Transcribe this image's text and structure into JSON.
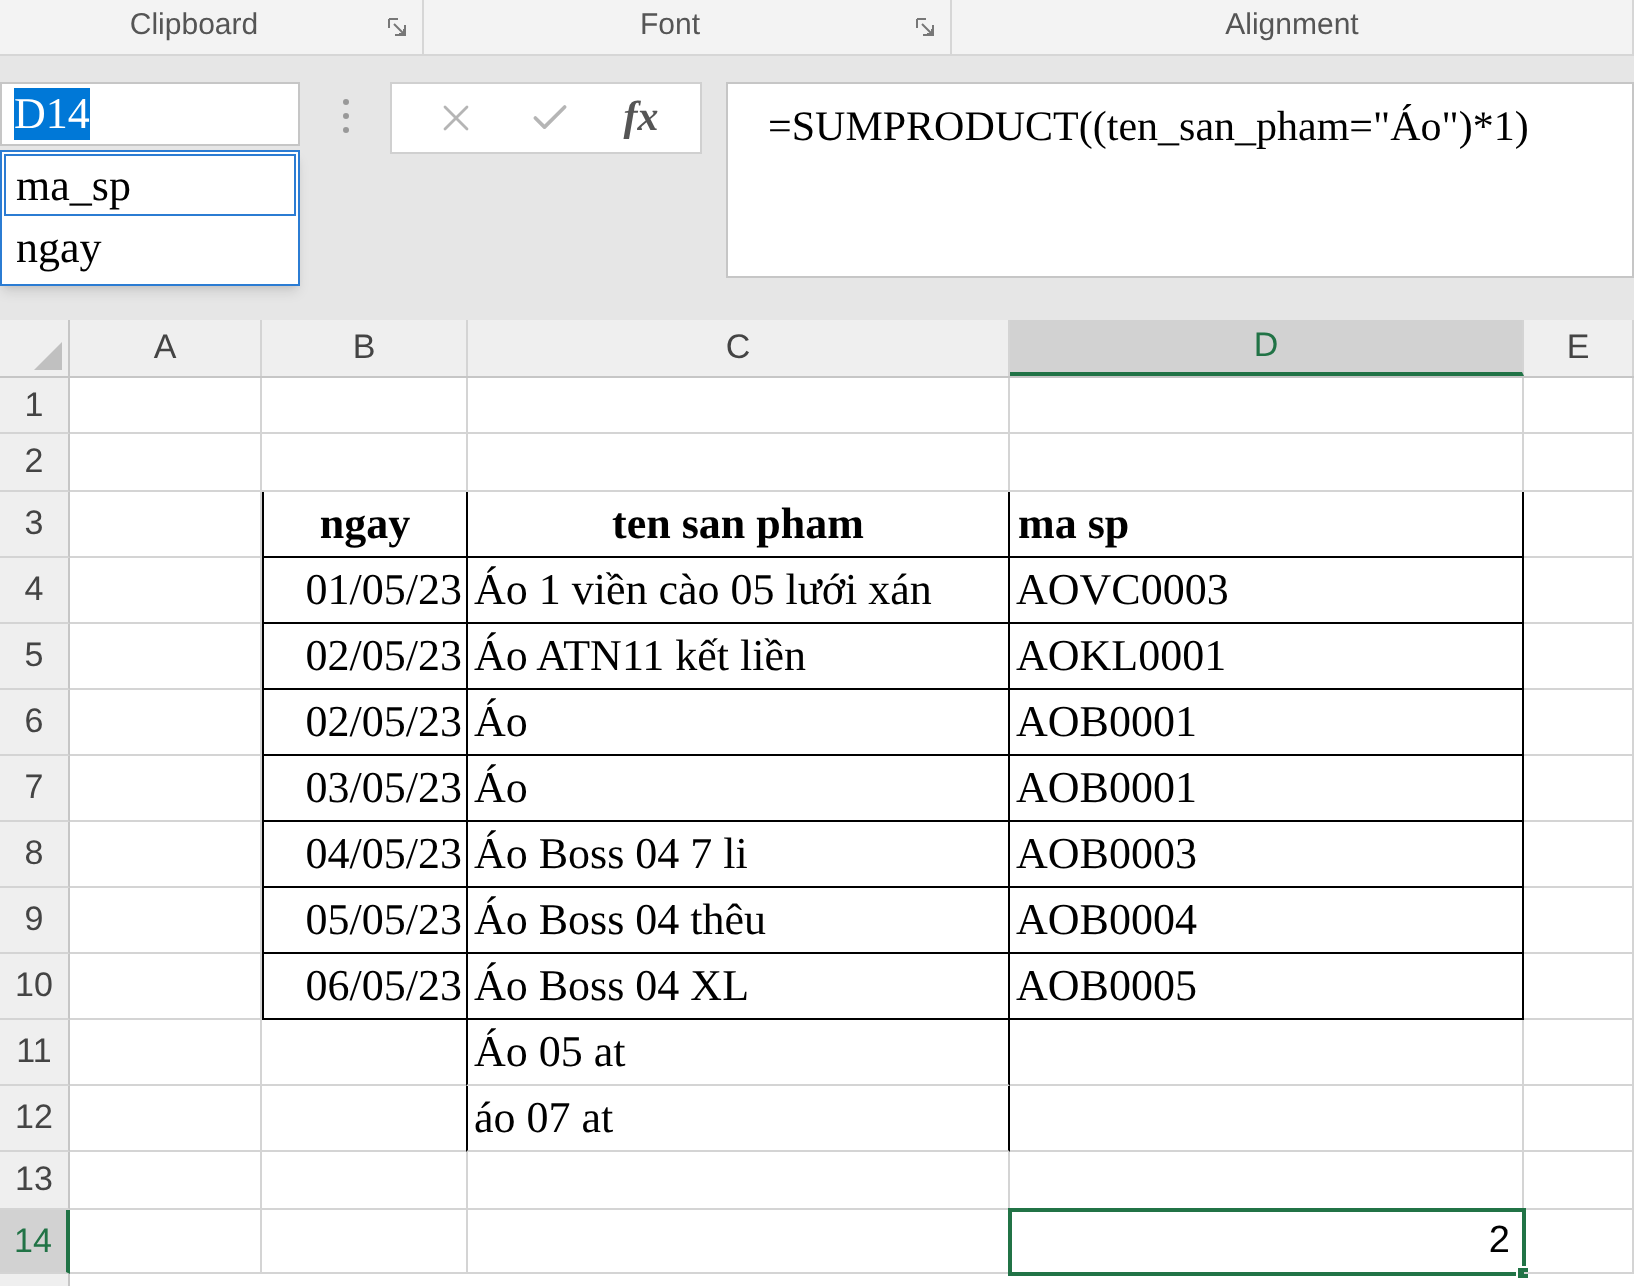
{
  "ribbon_groups": [
    {
      "label": "Clipboard",
      "launcher": true
    },
    {
      "label": "Font",
      "launcher": true
    },
    {
      "label": "Alignment",
      "launcher": false
    }
  ],
  "name_box": {
    "value": "D14",
    "highlighted": true
  },
  "name_list": [
    {
      "label": "ma_sp",
      "selected": true
    },
    {
      "label": "ngay",
      "selected": false
    }
  ],
  "fx_label": "fx",
  "formula": "=SUMPRODUCT((ten_san_pham=\"Áo\")*1)",
  "columns": [
    {
      "label": "A",
      "selected": false
    },
    {
      "label": "B",
      "selected": false
    },
    {
      "label": "C",
      "selected": false
    },
    {
      "label": "D",
      "selected": true
    },
    {
      "label": "E",
      "selected": false
    }
  ],
  "rows": [
    {
      "label": "1",
      "selected": false,
      "kind": "plain",
      "cells": {}
    },
    {
      "label": "2",
      "selected": false,
      "kind": "plain",
      "cells": {}
    },
    {
      "label": "3",
      "selected": false,
      "kind": "boxed",
      "cells": {
        "B": {
          "text": "ngay",
          "kind": "header",
          "active": false
        },
        "C": {
          "text": "ten san pham",
          "kind": "header",
          "active": false
        },
        "D": {
          "text": "ma sp",
          "kind": "header",
          "active": false
        }
      }
    },
    {
      "label": "4",
      "selected": false,
      "kind": "boxed",
      "cells": {
        "B": {
          "text": "01/05/23",
          "kind": "date",
          "active": false
        },
        "C": {
          "text": "Áo 1 viền cào 05 lưới xán",
          "kind": "text",
          "active": false
        },
        "D": {
          "text": "AOVC0003",
          "kind": "text",
          "active": false
        }
      }
    },
    {
      "label": "5",
      "selected": false,
      "kind": "boxed",
      "cells": {
        "B": {
          "text": "02/05/23",
          "kind": "date",
          "active": false
        },
        "C": {
          "text": "Áo ATN11 kết liền",
          "kind": "text",
          "active": false
        },
        "D": {
          "text": "AOKL0001",
          "kind": "text",
          "active": false
        }
      }
    },
    {
      "label": "6",
      "selected": false,
      "kind": "boxed",
      "cells": {
        "B": {
          "text": "02/05/23",
          "kind": "date",
          "active": false
        },
        "C": {
          "text": "Áo",
          "kind": "text",
          "active": false
        },
        "D": {
          "text": "AOB0001",
          "kind": "text",
          "active": false
        }
      }
    },
    {
      "label": "7",
      "selected": false,
      "kind": "boxed",
      "cells": {
        "B": {
          "text": "03/05/23",
          "kind": "date",
          "active": false
        },
        "C": {
          "text": "Áo",
          "kind": "text",
          "active": false
        },
        "D": {
          "text": "AOB0001",
          "kind": "text",
          "active": false
        }
      }
    },
    {
      "label": "8",
      "selected": false,
      "kind": "boxed",
      "cells": {
        "B": {
          "text": "04/05/23",
          "kind": "date",
          "active": false
        },
        "C": {
          "text": "Áo Boss 04 7 li",
          "kind": "text",
          "active": false
        },
        "D": {
          "text": "AOB0003",
          "kind": "text",
          "active": false
        }
      }
    },
    {
      "label": "9",
      "selected": false,
      "kind": "boxed",
      "cells": {
        "B": {
          "text": "05/05/23",
          "kind": "date",
          "active": false
        },
        "C": {
          "text": "Áo Boss 04 thêu",
          "kind": "text",
          "active": false
        },
        "D": {
          "text": "AOB0004",
          "kind": "text",
          "active": false
        }
      }
    },
    {
      "label": "10",
      "selected": false,
      "kind": "boxed",
      "cells": {
        "B": {
          "text": "06/05/23",
          "kind": "date",
          "active": false
        },
        "C": {
          "text": "Áo Boss 04 XL",
          "kind": "text",
          "active": false
        },
        "D": {
          "text": "AOB0005",
          "kind": "text",
          "active": false
        }
      }
    },
    {
      "label": "11",
      "selected": false,
      "kind": "sides",
      "cells": {
        "C": {
          "text": "Áo 05 at",
          "kind": "text",
          "active": false
        }
      }
    },
    {
      "label": "12",
      "selected": false,
      "kind": "sides",
      "cells": {
        "C": {
          "text": "áo 07 at",
          "kind": "text",
          "active": false
        }
      }
    },
    {
      "label": "13",
      "selected": false,
      "kind": "plain",
      "cells": {}
    },
    {
      "label": "14",
      "selected": true,
      "kind": "plain",
      "cells": {
        "D": {
          "text": "2",
          "kind": "number",
          "active": true
        }
      }
    }
  ]
}
